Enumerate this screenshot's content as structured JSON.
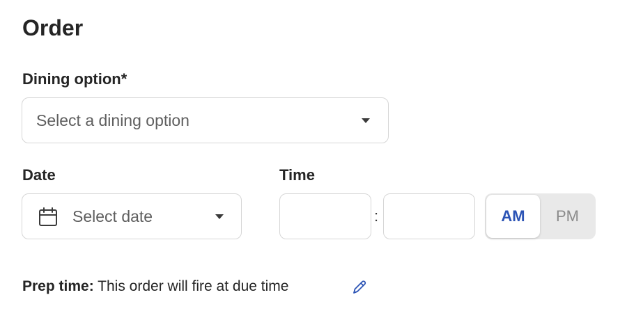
{
  "section": {
    "title": "Order"
  },
  "dining": {
    "label": "Dining option*",
    "placeholder": "Select a dining option"
  },
  "date": {
    "label": "Date",
    "placeholder": "Select date"
  },
  "time": {
    "label": "Time",
    "hour_value": "",
    "minute_value": "",
    "separator": ":",
    "am_label": "AM",
    "pm_label": "PM",
    "selected_period": "AM"
  },
  "prep": {
    "label": "Prep time:",
    "text": "This order will fire at due time"
  },
  "icons": {
    "dining_caret": "chevron-down-icon",
    "date_calendar": "calendar-icon",
    "date_caret": "chevron-down-icon",
    "prep_edit": "pencil-icon"
  },
  "colors": {
    "accent": "#2b53b5",
    "toggle_bg": "#e9e9e9",
    "border": "#d6d6d6"
  }
}
